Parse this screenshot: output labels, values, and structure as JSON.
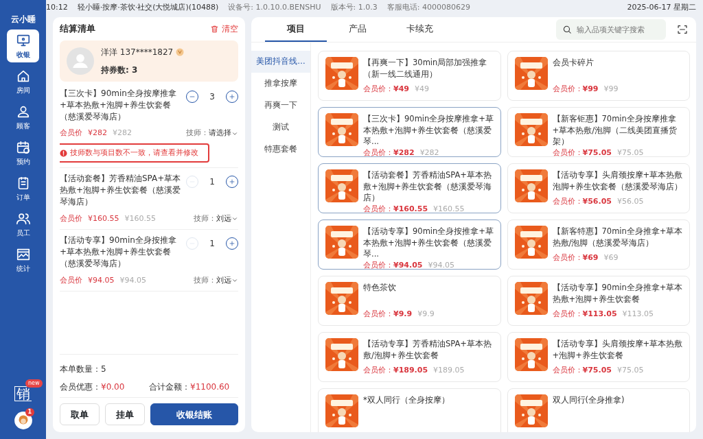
{
  "status_bar": {
    "time": "10:12",
    "store": "轻小睡·按摩·茶饮·社交(大悦城店)(10488)",
    "device": "设备号: 1.0.10.0.BENSHU",
    "version": "版本号: 1.0.3",
    "hotline": "客服电话: 4000080629",
    "date": "2025-06-17 星期二"
  },
  "sidebar": {
    "logo": "云小睡",
    "items": [
      {
        "label": "收银",
        "selected": true
      },
      {
        "label": "房间",
        "selected": false
      },
      {
        "label": "顾客",
        "selected": false
      },
      {
        "label": "预约",
        "selected": false
      },
      {
        "label": "订单",
        "selected": false
      },
      {
        "label": "员工",
        "selected": false
      },
      {
        "label": "统计",
        "selected": false
      }
    ],
    "promo": {
      "badge": "new",
      "label": "销"
    },
    "avatar_badge": "1"
  },
  "cart": {
    "title": "结算清单",
    "clear": "清空",
    "member": {
      "name": "洋洋 137****1827",
      "vip": true,
      "coupons": "持券数: 3"
    },
    "items": [
      {
        "name": "【三次卡】90min全身按摩推拿+草本热敷+泡脚+养生饮套餐（慈溪爱琴海店）",
        "quantity": "3",
        "can_decrease": true,
        "member_label": "会员价",
        "member_price": "¥282",
        "price": "¥282",
        "tech_label": "技师：",
        "tech": "请选择",
        "warning": "技师数与项目数不一致，请查看并修改"
      },
      {
        "name": "【活动套餐】芳香精油SPA+草本热敷+泡脚+养生饮套餐（慈溪爱琴海店）",
        "quantity": "1",
        "can_decrease": false,
        "member_label": "会员价",
        "member_price": "¥160.55",
        "price": "¥160.55",
        "tech_label": "技师：",
        "tech": "刘远"
      },
      {
        "name": "【活动专享】90min全身按推拿+草本热敷+泡脚+养生饮套餐（慈溪爱琴海店）",
        "quantity": "1",
        "can_decrease": false,
        "member_label": "会员价",
        "member_price": "¥94.05",
        "price": "¥94.05",
        "tech_label": "技师：",
        "tech": "刘远"
      }
    ],
    "count_label": "本单数量：",
    "count": "5",
    "discount_label": "会员优惠：",
    "discount": "¥0.00",
    "total_label": "合计金额：",
    "total": "¥1100.60",
    "buttons": [
      {
        "label": "取单",
        "kind": "secondary"
      },
      {
        "label": "挂单",
        "kind": "secondary"
      },
      {
        "label": "收银结账",
        "kind": "primary"
      }
    ]
  },
  "catalog": {
    "tabs": [
      {
        "label": "项目",
        "selected": true
      },
      {
        "label": "产品",
        "selected": false
      },
      {
        "label": "卡续充",
        "selected": false
      }
    ],
    "search": {
      "placeholder": "输入品项关键字搜索"
    },
    "categories": [
      {
        "label": "美团抖音线…",
        "selected": true
      },
      {
        "label": "推拿按摩",
        "selected": false
      },
      {
        "label": "再爽一下",
        "selected": false
      },
      {
        "label": "测试",
        "selected": false
      },
      {
        "label": "特惠套餐",
        "selected": false
      }
    ],
    "products": [
      {
        "name": "【再爽一下】30min局部加强推拿（新一线二线通用）",
        "member_label": "会员价：",
        "member_price": "¥49",
        "price": "¥49",
        "selected": false
      },
      {
        "name": "会员卡碎片",
        "member_label": "会员价：",
        "member_price": "¥99",
        "price": "¥99",
        "selected": false
      },
      {
        "name": "【三次卡】90min全身按摩推拿+草本热敷+泡脚+养生饮套餐（慈溪爱琴...",
        "member_label": "会员价：",
        "member_price": "¥282",
        "price": "¥282",
        "selected": true
      },
      {
        "name": "【新客钜惠】70min全身按摩推拿+草本热敷/泡脚（二线美团直播货架）",
        "member_label": "会员价：",
        "member_price": "¥75.05",
        "price": "¥75.05",
        "selected": false
      },
      {
        "name": "【活动套餐】芳香精油SPA+草本热敷+泡脚+养生饮套餐（慈溪爱琴海店）",
        "member_label": "会员价：",
        "member_price": "¥160.55",
        "price": "¥160.55",
        "selected": true
      },
      {
        "name": "【活动专享】头肩颈按摩+草本热敷泡脚+养生饮套餐（慈溪爱琴海店）",
        "member_label": "会员价：",
        "member_price": "¥56.05",
        "price": "¥56.05",
        "selected": false
      },
      {
        "name": "【活动专享】90min全身按推拿+草本热敷+泡脚+养生饮套餐（慈溪爱琴...",
        "member_label": "会员价：",
        "member_price": "¥94.05",
        "price": "¥94.05",
        "selected": true
      },
      {
        "name": "【新客特惠】70min全身推拿+草本热敷/泡脚（慈溪爱琴海店）",
        "member_label": "会员价：",
        "member_price": "¥69",
        "price": "¥69",
        "selected": false
      },
      {
        "name": "特色茶饮",
        "member_label": "会员价：",
        "member_price": "¥9.9",
        "price": "¥9.9",
        "selected": false
      },
      {
        "name": "【活动专享】90min全身推拿+草本热敷+泡脚+养生饮套餐",
        "member_label": "会员价：",
        "member_price": "¥113.05",
        "price": "¥113.05",
        "selected": false
      },
      {
        "name": "【活动专享】芳香精油SPA+草本热敷/泡脚+养生饮套餐",
        "member_label": "会员价：",
        "member_price": "¥189.05",
        "price": "¥189.05",
        "selected": false
      },
      {
        "name": "【活动专享】头肩颈按摩+草本热敷+泡脚+养生饮套餐",
        "member_label": "会员价：",
        "member_price": "¥75.05",
        "price": "¥75.05",
        "selected": false
      },
      {
        "name": "*双人同行（全身按摩）",
        "selected": false
      },
      {
        "name": "双人同行(全身推拿)",
        "selected": false
      }
    ]
  }
}
